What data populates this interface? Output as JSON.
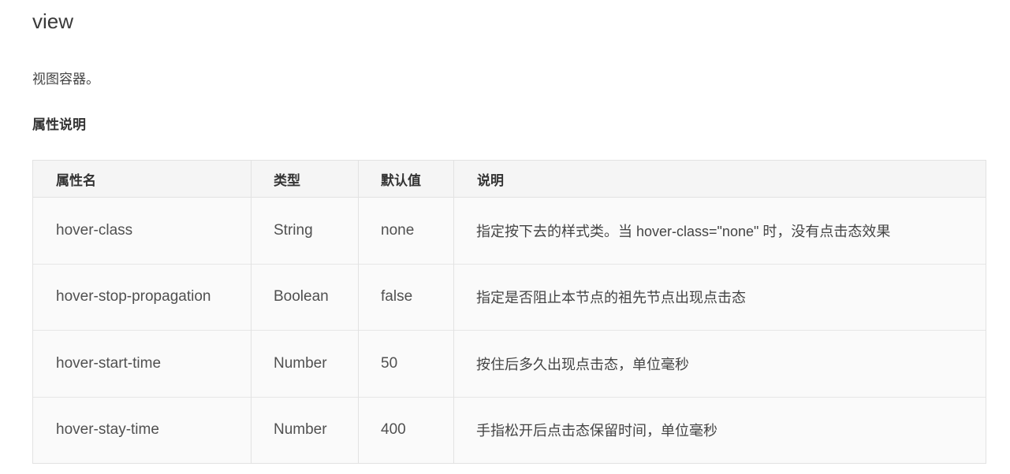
{
  "page": {
    "title": "view",
    "description": "视图容器。",
    "section_title": "属性说明"
  },
  "table": {
    "headers": [
      "属性名",
      "类型",
      "默认值",
      "说明"
    ],
    "rows": [
      [
        "hover-class",
        "String",
        "none",
        "指定按下去的样式类。当 hover-class=\"none\" 时，没有点击态效果"
      ],
      [
        "hover-stop-propagation",
        "Boolean",
        "false",
        "指定是否阻止本节点的祖先节点出现点击态"
      ],
      [
        "hover-start-time",
        "Number",
        "50",
        "按住后多久出现点击态，单位毫秒"
      ],
      [
        "hover-stay-time",
        "Number",
        "400",
        "手指松开后点击态保留时间，单位毫秒"
      ]
    ]
  }
}
